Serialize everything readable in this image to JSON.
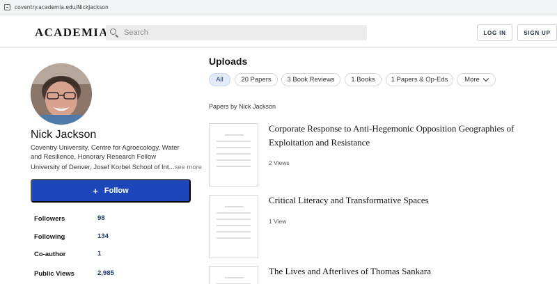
{
  "browser": {
    "url": "coventry.academia.edu/NickJackson"
  },
  "header": {
    "logo": "ACADEMIA",
    "search_placeholder": "Search",
    "login_label": "LOG IN",
    "signup_label": "SIGN UP"
  },
  "profile": {
    "name": "Nick Jackson",
    "affiliation_1": "Coventry University, Centre for Agroecology, Water and Resilience, Honorary Research Fellow",
    "affiliation_2": "University of Denver, Josef Korbel School of Int...",
    "see_more": "see more",
    "follow_label": "Follow",
    "follow_icon": "+",
    "stats": [
      {
        "label": "Followers",
        "value": "98"
      },
      {
        "label": "Following",
        "value": "134"
      },
      {
        "label": "Co-author",
        "value": "1"
      },
      {
        "label": "Public Views",
        "value": "2,985"
      }
    ]
  },
  "uploads": {
    "title": "Uploads",
    "filters": [
      "All",
      "20 Papers",
      "3 Book Reviews",
      "1 Books",
      "1 Papers & Op-Eds",
      "More"
    ],
    "active_filter": "All",
    "papers_by": "Papers by Nick Jackson",
    "papers": [
      {
        "title": "Corporate Response to Anti-Hegemonic Opposition Geographies of Exploitation and Resistance",
        "views": "2 Views"
      },
      {
        "title": "Critical Literacy and Transformative Spaces",
        "views": "1 View"
      },
      {
        "title": "The Lives and Afterlives of Thomas Sankara",
        "views": ""
      }
    ]
  },
  "colors": {
    "follow_button": "#1d47b8",
    "active_chip": "#e3ebf8",
    "stat_value": "#1f3a6e"
  }
}
